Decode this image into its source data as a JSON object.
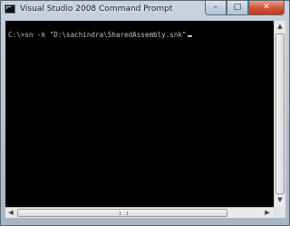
{
  "window": {
    "title": "Visual Studio 2008 Command Prompt",
    "icon": "console-icon",
    "buttons": {
      "minimize_glyph": "–",
      "maximize_glyph": "□",
      "close_glyph": "✕"
    }
  },
  "console": {
    "prompt_text": "C:\\>sn -k \"D:\\sachindra\\SharedAssembly.snk\"",
    "background": "#000000",
    "text_color": "#c0c0c0"
  },
  "scrollbars": {
    "up_glyph": "▲",
    "down_glyph": "▼",
    "left_glyph": "◀",
    "right_glyph": "▶"
  }
}
